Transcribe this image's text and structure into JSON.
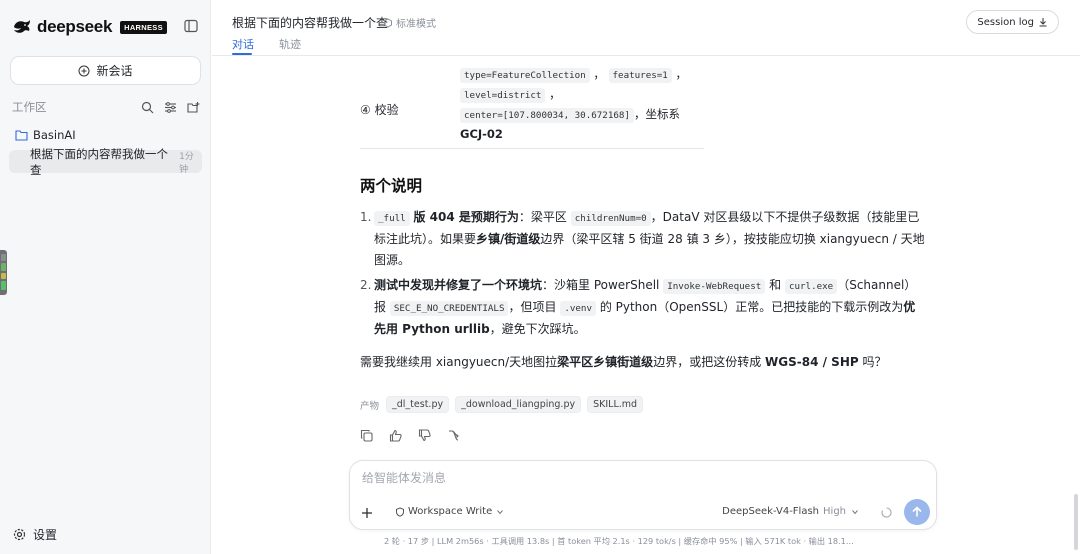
{
  "brand": {
    "name": "deepseek",
    "badge": "HARNESS"
  },
  "sidebar": {
    "new_chat_label": "新会话",
    "workspace_label": "工作区",
    "folder_name": "BasinAI",
    "session": {
      "title": "根据下面的内容帮我做一个查",
      "time": "1分钟"
    },
    "settings_label": "设置"
  },
  "topbar": {
    "title": "根据下面的内容帮我做一个查",
    "mode": "标准模式",
    "tabs": [
      {
        "label": "对话",
        "active": true
      },
      {
        "label": "轨迹",
        "active": false
      }
    ],
    "session_log_label": "Session log"
  },
  "verify_row": {
    "label": "④ 校验",
    "code1": "type=FeatureCollection",
    "code2": "features=1",
    "code3": "level=district",
    "code4": "center=[107.800034, 30.672168]",
    "text_coord": "，坐标系",
    "crs": "GCJ-02"
  },
  "notes": {
    "title": "两个说明",
    "item1": {
      "num": "1.",
      "code_full": "_full",
      "bold1": "版 404 是预期行为",
      "t1": "：梁平区",
      "code_children": "childrenNum=0",
      "t2": "，DataV 对区县级以下不提供子级数据（技能里已标注此坑）。如果要",
      "bold2": "乡镇/街道级",
      "t3": "边界（梁平区辖 5 街道 28 镇 3 乡），按技能应切换 xiangyuecn / 天地图源。"
    },
    "item2": {
      "num": "2.",
      "bold1": "测试中发现并修复了一个环境坑",
      "t1": "：沙箱里 PowerShell",
      "code_iwr": "Invoke-WebRequest",
      "t2": "和",
      "code_curl": "curl.exe",
      "t3": "（Schannel）报",
      "code_err": "SEC_E_NO_CREDENTIALS",
      "t4": "，但项目",
      "code_venv": ".venv",
      "t5": "的 Python（OpenSSL）正常。已把技能的下载示例改为",
      "bold2": "优先用 Python urllib",
      "t6": "，避免下次踩坑。"
    }
  },
  "question": {
    "t1": "需要我继续用 xiangyuecn/天地图拉",
    "bold1": "梁平区乡镇街道级",
    "t2": "边界，或把这份转成",
    "bold2": "WGS-84 / SHP",
    "t3": "吗？"
  },
  "artifacts": {
    "label": "产物",
    "files": [
      "_dl_test.py",
      "_download_liangping.py",
      "SKILL.md"
    ]
  },
  "composer": {
    "placeholder": "给智能体发消息",
    "permission": "Workspace Write",
    "model": "DeepSeek-V4-Flash",
    "level": "High"
  },
  "status": "2 轮 · 17 步  |  LLM 2m56s · 工具调用 13.8s  |  首 token 平均 2.1s · 129 tok/s  |  缓存命中 95%  |  输入 571K tok · 输出 18.1...",
  "colors": {
    "accent": "#2f6bda",
    "send": "#9ab7ec",
    "sidebar_bg": "#f6f7f8"
  }
}
